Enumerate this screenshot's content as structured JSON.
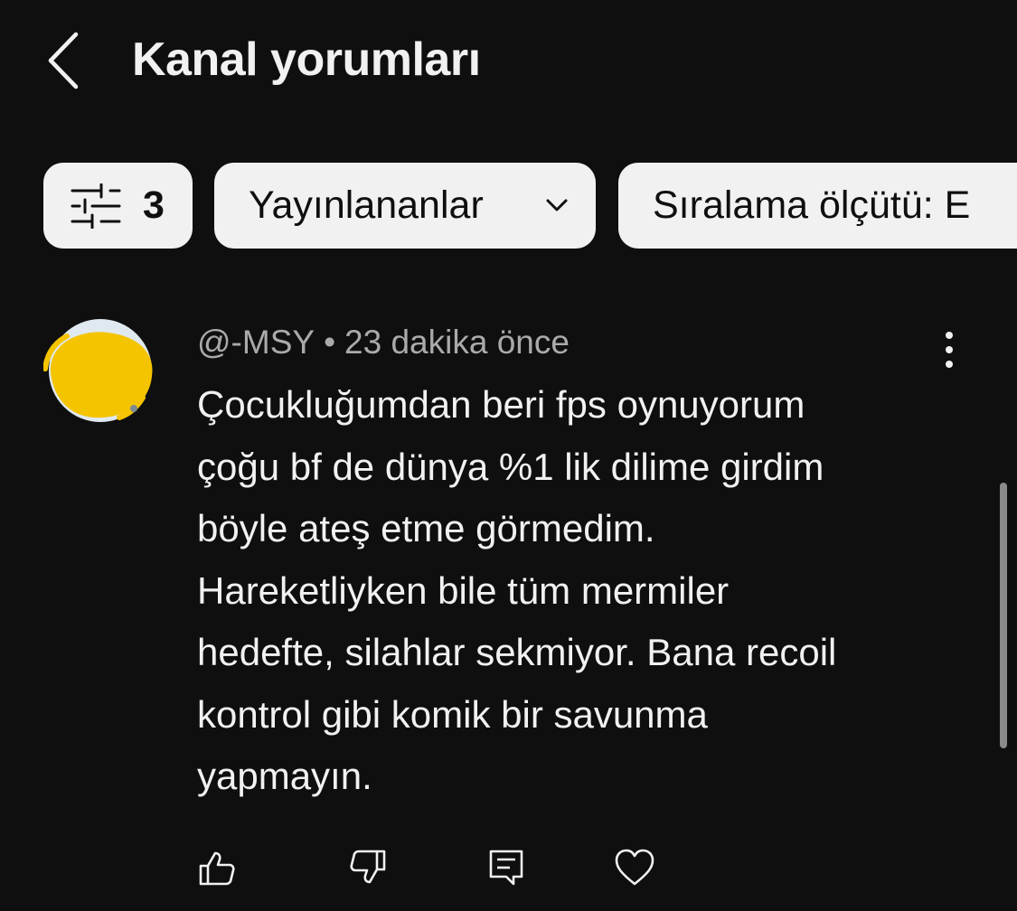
{
  "header": {
    "title": "Kanal yorumları",
    "back_icon": "chevron-left-icon"
  },
  "filters": {
    "filter_icon": "sliders-icon",
    "filter_count": "3",
    "status_label": "Yayınlananlar",
    "status_chevron_icon": "chevron-down-icon",
    "sort_label": "Sıralama ölçütü: E"
  },
  "comment": {
    "avatar_color": "#f5c400",
    "author": "@-MSY",
    "separator": "•",
    "time": "23 dakika önce",
    "text": "Çocukluğumdan beri fps oynuyorum\nçoğu bf de dünya %1 lik dilime girdim\nböyle ateş etme görmedim.\nHareketliyken bile tüm mermiler\nhedefte, silahlar sekmiyor. Bana recoil\nkontrol gibi komik bir savunma\nyapmayın.",
    "more_icon": "more-vertical-icon",
    "actions": {
      "like_icon": "thumb-up-icon",
      "dislike_icon": "thumb-down-icon",
      "reply_icon": "reply-comment-icon",
      "heart_icon": "heart-icon"
    }
  },
  "colors": {
    "background": "#0f0f0f",
    "chip_background": "#f1f1f1",
    "meta_text": "#aaaaaa",
    "primary_text": "#f1f1f1"
  }
}
